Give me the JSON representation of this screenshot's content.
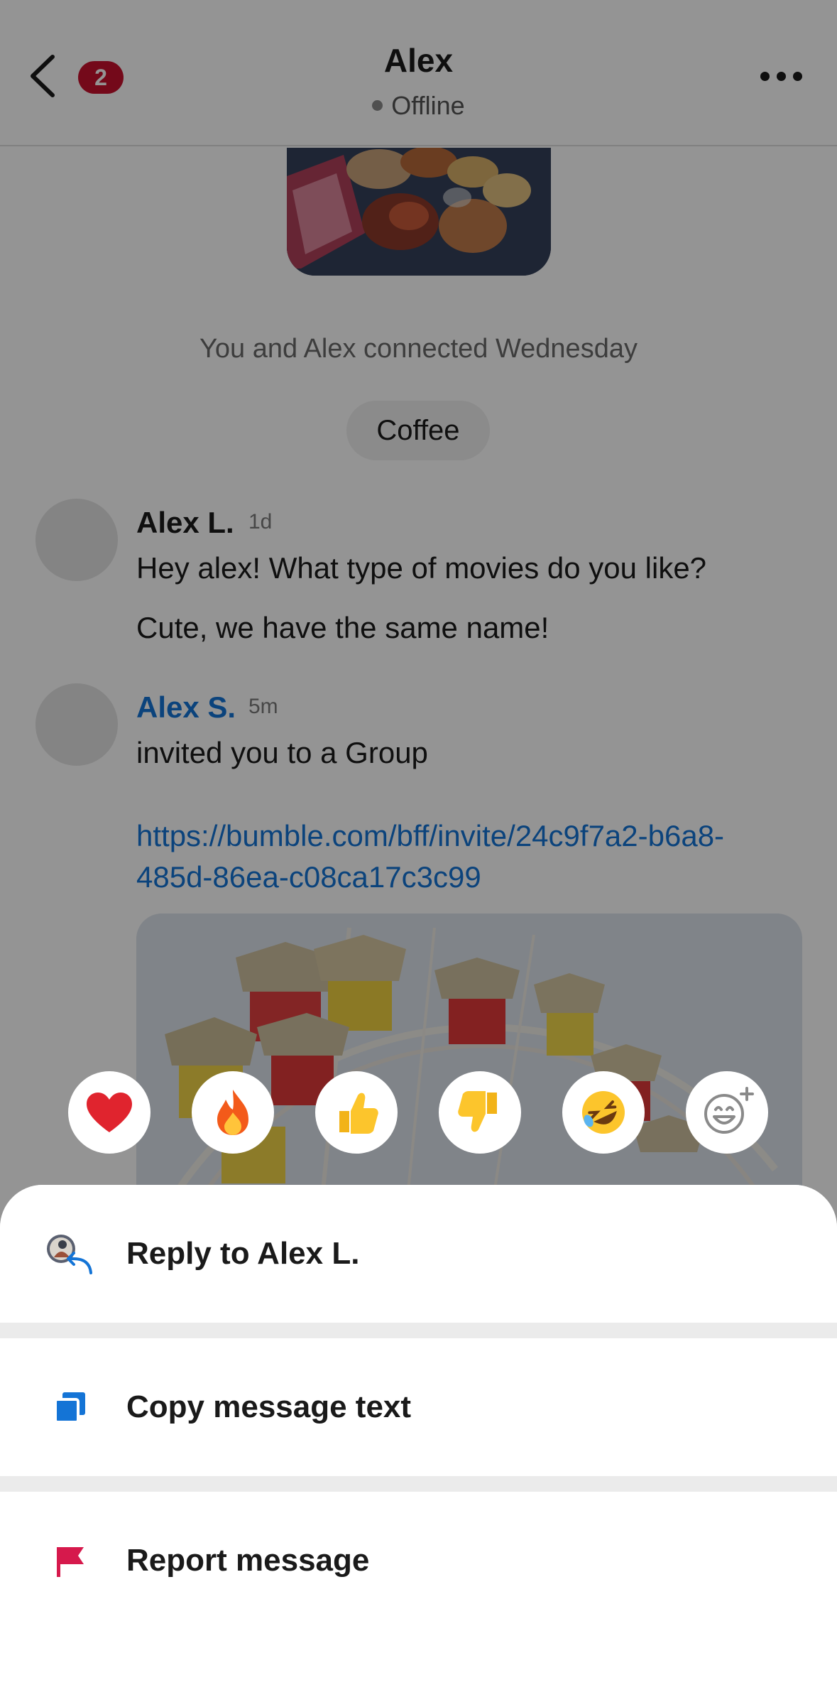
{
  "header": {
    "title": "Alex",
    "status": "Offline",
    "unread_count": "2"
  },
  "chat": {
    "connected_text": "You and Alex connected Wednesday",
    "topic": "Coffee",
    "messages": [
      {
        "sender": "Alex L.",
        "time": "1d",
        "lines": [
          "Hey alex! What type of movies do you like?",
          "Cute, we have the same name!"
        ]
      },
      {
        "sender": "Alex S.",
        "time": "5m",
        "lines": [
          "invited you to a Group"
        ],
        "link": "https://bumble.com/bff/invite/24c9f7a2-b6a8-485d-86ea-c08ca17c3c99"
      }
    ]
  },
  "reactions": [
    {
      "icon": "heart-icon",
      "glyph": "❤"
    },
    {
      "icon": "fire-icon",
      "glyph": "🔥"
    },
    {
      "icon": "thumbs-up-icon",
      "glyph": "👍"
    },
    {
      "icon": "thumbs-down-icon",
      "glyph": "👎"
    },
    {
      "icon": "rofl-icon",
      "glyph": "🤣"
    },
    {
      "icon": "add-reaction-icon",
      "glyph": ""
    }
  ],
  "sheet": {
    "reply_label": "Reply to Alex L.",
    "copy_label": "Copy message text",
    "report_label": "Report message"
  },
  "colors": {
    "accent_blue": "#1474d6",
    "badge_red": "#c8102e",
    "report_red": "#d6194c",
    "dim_overlay": "rgba(0,0,0,0.42)"
  }
}
